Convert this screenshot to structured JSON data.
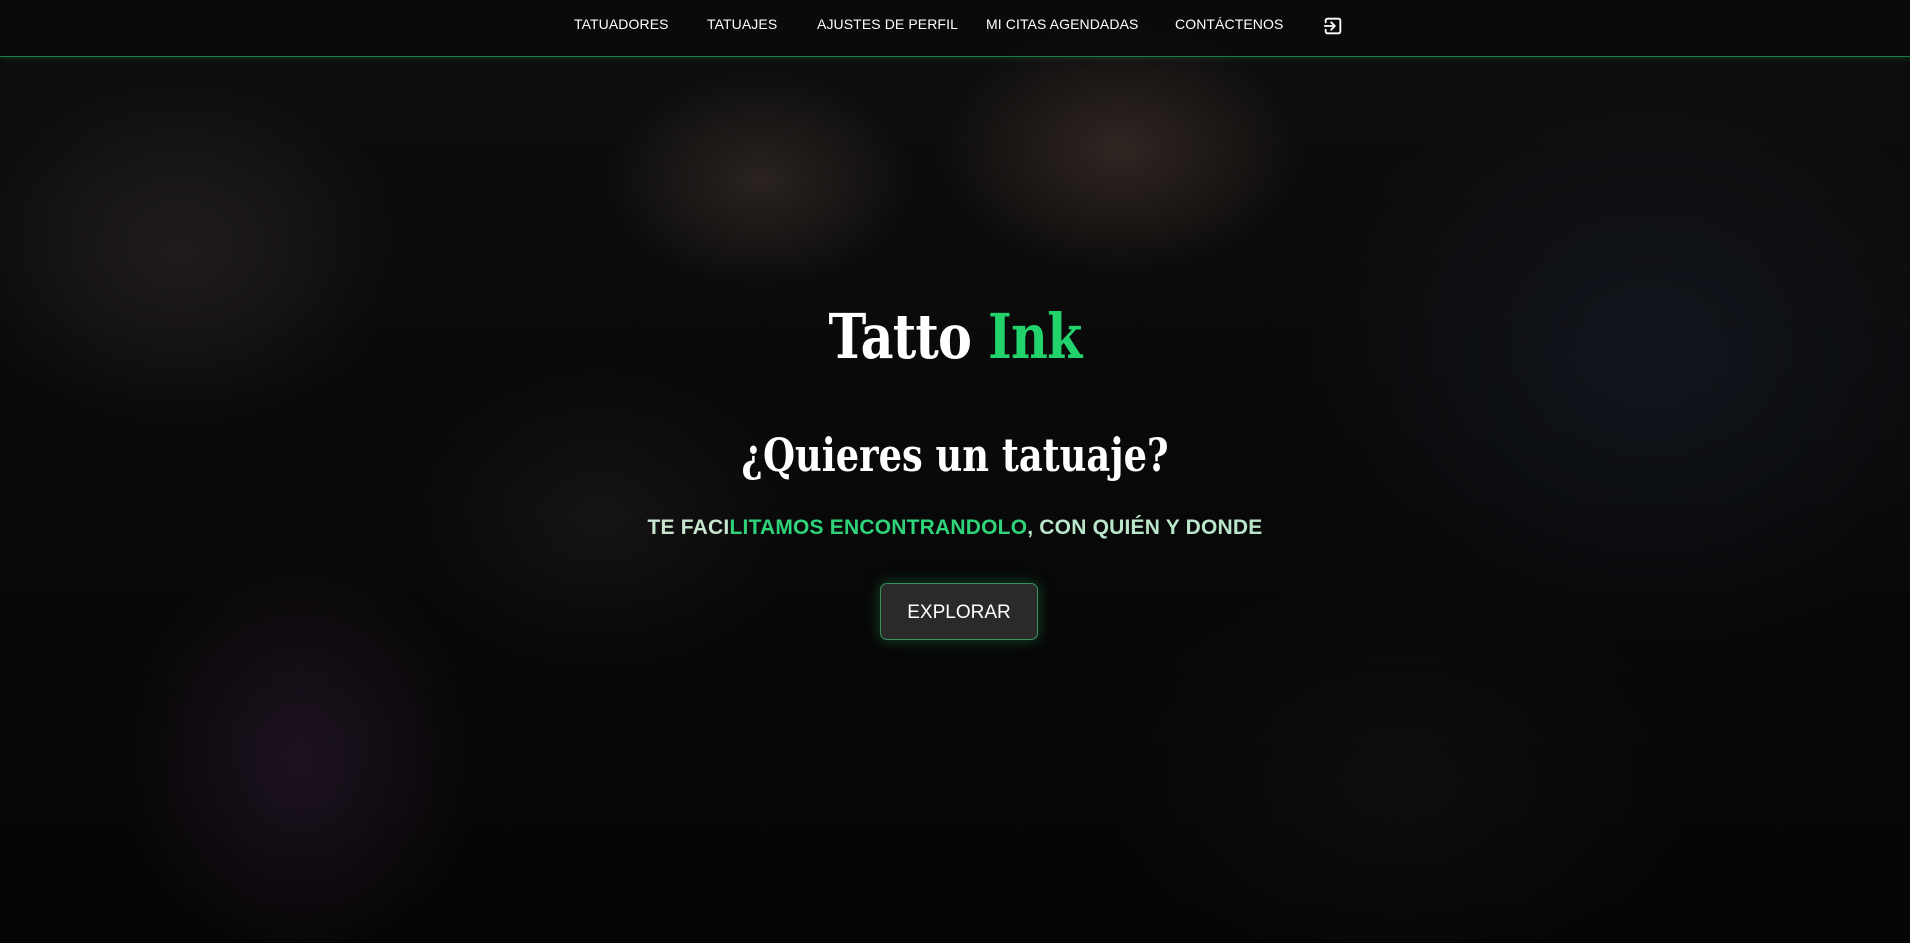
{
  "nav": {
    "items": [
      {
        "label": "TATUADORES"
      },
      {
        "label": "TATUAJES"
      },
      {
        "label": "AJUSTES DE PERFIL"
      },
      {
        "label": "MI CITAS AGENDADAS"
      },
      {
        "label": "CONTÁCTENOS"
      }
    ],
    "logout_icon": "logout-icon"
  },
  "hero": {
    "brand_part1": "Tatto",
    "brand_part2": "Ink",
    "headline": "¿Quieres un tatuaje?",
    "tagline_part1": "TE FACI",
    "tagline_part2": "LITAMOS ENCONTRANDOLO",
    "tagline_part3": ", CON QUIÉN Y DONDE",
    "cta_label": "EXPLORAR"
  },
  "colors": {
    "accent": "#22d36b",
    "nav_border": "#1f7a45",
    "button_bg": "#2a2a2a"
  }
}
